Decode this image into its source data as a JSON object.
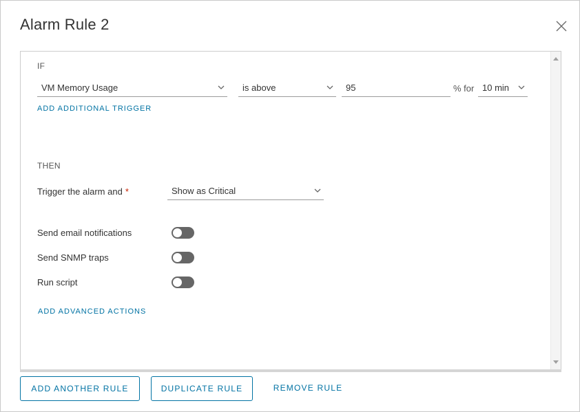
{
  "dialog": {
    "title": "Alarm Rule 2"
  },
  "if_section": {
    "label": "IF",
    "metric": "VM Memory Usage",
    "operator": "is above",
    "threshold": "95",
    "unit_for": "% for",
    "duration": "10 min",
    "add_trigger_label": "ADD ADDITIONAL TRIGGER"
  },
  "then_section": {
    "label": "THEN",
    "trigger_label": "Trigger the alarm and",
    "required_mark": "*",
    "severity": "Show as Critical",
    "actions": [
      {
        "label": "Send email notifications",
        "enabled": false
      },
      {
        "label": "Send SNMP traps",
        "enabled": false
      },
      {
        "label": "Run script",
        "enabled": false
      }
    ],
    "add_advanced_label": "ADD ADVANCED ACTIONS"
  },
  "footer": {
    "add_rule_label": "ADD ANOTHER RULE",
    "duplicate_rule_label": "DUPLICATE RULE",
    "remove_rule_label": "REMOVE RULE"
  },
  "colors": {
    "accent": "#0072a3",
    "required": "#c92100",
    "toggle_off": "#666666"
  }
}
